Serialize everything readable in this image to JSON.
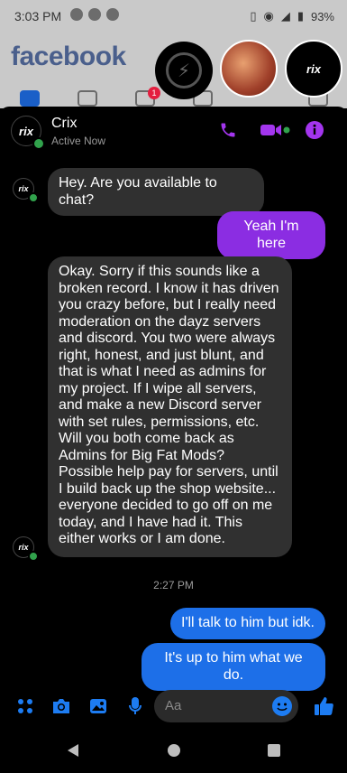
{
  "status_bar": {
    "time": "3:03 PM",
    "battery": "93%"
  },
  "background_app": {
    "logo": "facebook",
    "notification_count": "1"
  },
  "chathead_crix_label": "rix",
  "chat": {
    "contact_name": "Crix",
    "contact_status": "Active Now",
    "avatar_label": "rix",
    "messages": [
      {
        "from": "contact",
        "text": "Hey. Are you available to chat?"
      },
      {
        "from": "me",
        "text": "Yeah I'm here"
      },
      {
        "from": "contact",
        "text": "Okay. Sorry if this sounds like a broken record. I know it has driven you crazy before, but I really need moderation on the dayz servers and discord. You two were always right, honest, and just blunt, and that is what I need as admins for my project. If I wipe all servers, and make a new Discord server with set rules, permissions, etc. Will you both come back as Admins for Big Fat Mods? Possible help pay for servers, until I build back up the shop website... everyone decided to go off on me today, and I have had it. This either works or I am done."
      },
      {
        "from": "me",
        "text": "I'll talk to him but idk."
      },
      {
        "from": "me",
        "text": "It's up to him what we do."
      }
    ],
    "timestamp": "2:27 PM"
  },
  "composer": {
    "placeholder": "Aa"
  },
  "colors": {
    "purple": "#8b2de2",
    "blue": "#1d6fe8",
    "accent_icons": "#a335ee",
    "bubble_in": "#303030"
  },
  "icons": [
    "phone-icon",
    "video-icon",
    "info-icon",
    "apps-icon",
    "camera-icon",
    "gallery-icon",
    "mic-icon",
    "emoji-icon",
    "like-icon"
  ]
}
